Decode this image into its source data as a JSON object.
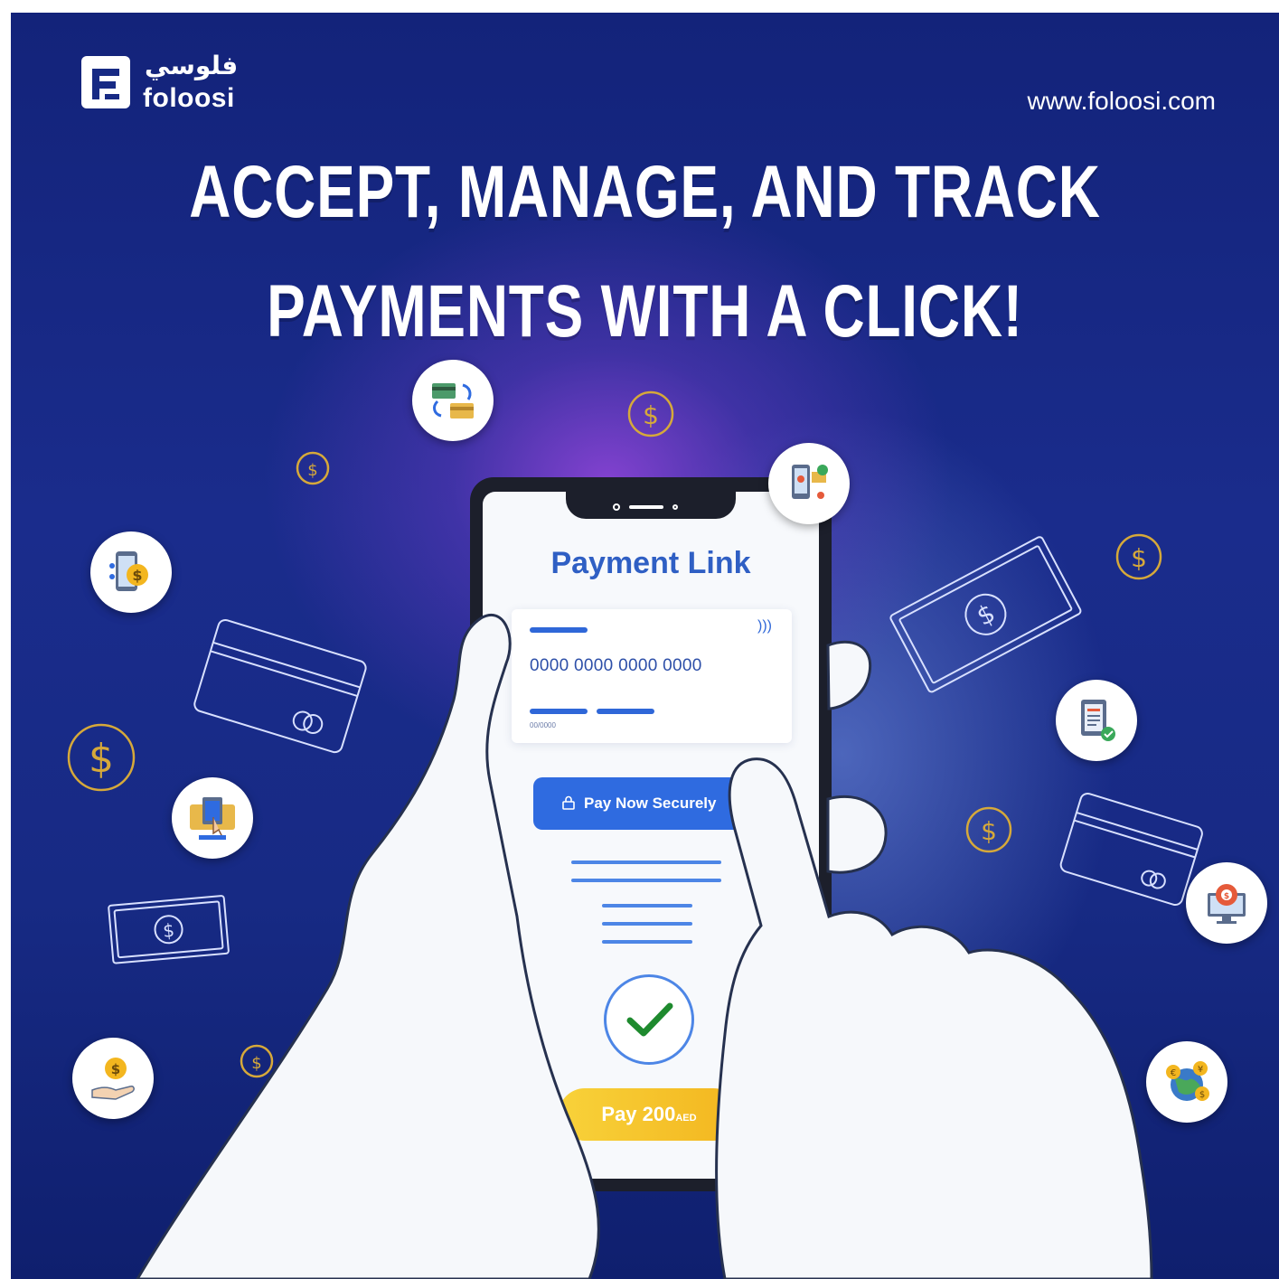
{
  "brand": {
    "name_arabic": "فلوسي",
    "name": "foloosi",
    "website": "www.foloosi.com"
  },
  "headline": {
    "line1": "ACCEPT, MANAGE, AND TRACK",
    "line2": "PAYMENTS WITH A CLICK!"
  },
  "phone_screen": {
    "title": "Payment Link",
    "card_number": "0000 0000 0000 0000",
    "card_expiry": "00/0000",
    "pay_button": "Pay Now Securely",
    "pay_amount": "Pay 200",
    "pay_currency": "AED"
  },
  "icons": [
    "card-exchange-icon",
    "mobile-payment-icon",
    "payment-tracking-icon",
    "invoice-check-icon",
    "card-tap-icon",
    "payment-gateway-icon",
    "money-hand-icon",
    "global-currency-icon",
    "dollar-coin-icon",
    "banknote-icon",
    "credit-card-icon",
    "checkmark-icon"
  ],
  "colors": {
    "background": "#172a84",
    "accent_blue": "#2f6be0",
    "title_blue": "#2f5fc4",
    "pay_yellow": "#f5c42a",
    "check_green": "#1e8a2e",
    "coin_gold": "#d6a93a"
  }
}
